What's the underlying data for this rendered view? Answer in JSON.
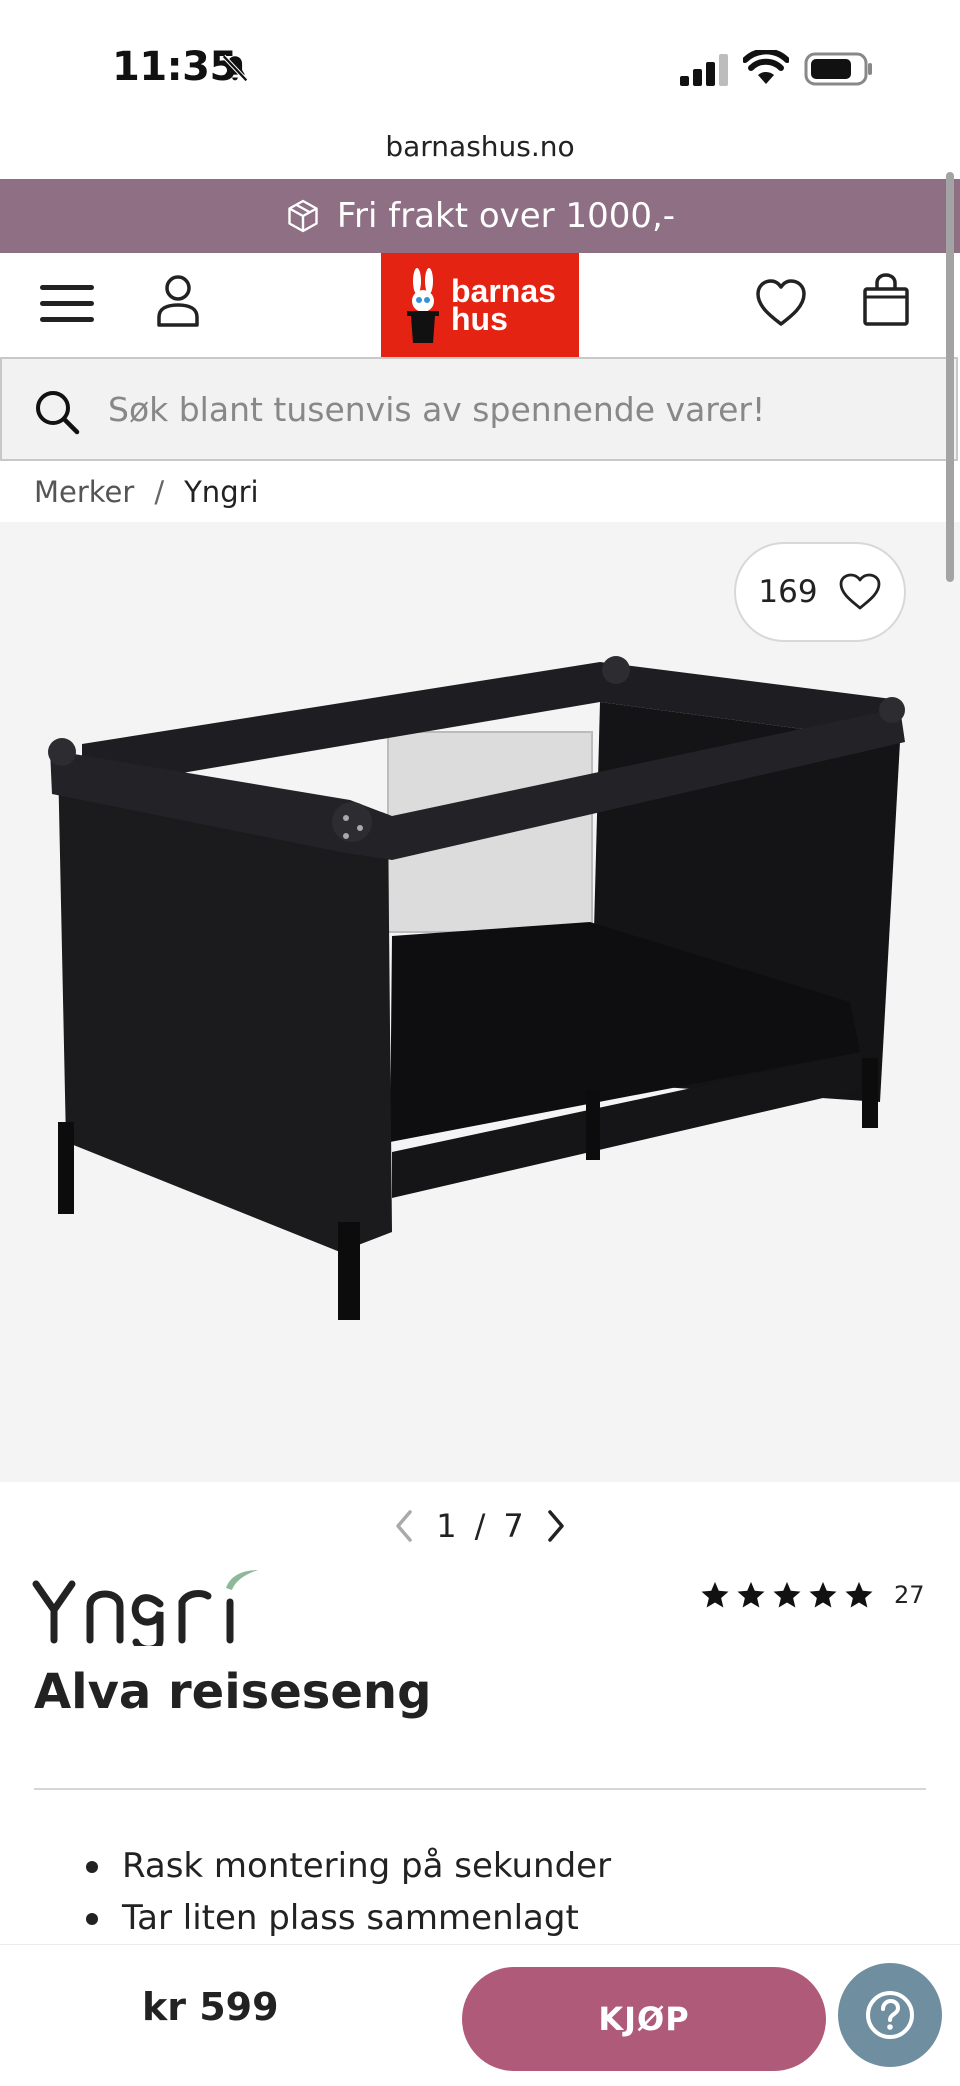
{
  "status_bar": {
    "time": "11:35",
    "icons": [
      "bell-slash-icon",
      "cellular-signal-icon",
      "wifi-icon",
      "battery-icon"
    ]
  },
  "browser": {
    "url": "barnashus.no"
  },
  "promo": {
    "icon": "package-icon",
    "text": "Fri frakt over 1000,-",
    "background": "#8e6f83"
  },
  "header": {
    "icons": [
      "menu-icon",
      "user-icon",
      "heart-icon",
      "shopping-bag-icon"
    ],
    "logo": {
      "line1": "barnas",
      "line2": "hus",
      "background": "#e42313"
    }
  },
  "search": {
    "placeholder": "Søk blant tusenvis av spennende varer!",
    "value": ""
  },
  "breadcrumb": {
    "items": [
      "Merker",
      "Yngri"
    ],
    "separator": "/"
  },
  "gallery": {
    "favorite_count": "169",
    "pager": {
      "current": "1",
      "separator": "/",
      "total": "7"
    }
  },
  "product": {
    "brand": "Yngri",
    "title": "Alva reiseseng",
    "rating": {
      "stars": 5,
      "count": "27"
    },
    "features": [
      "Rask montering på sekunder",
      "Tar liten plass sammenlagt"
    ]
  },
  "bottom_bar": {
    "price": "kr 599",
    "buy_label": "KJØP",
    "buy_color": "#b05a7a",
    "help_icon": "question-circle-icon",
    "help_color": "#6f8fa0"
  }
}
